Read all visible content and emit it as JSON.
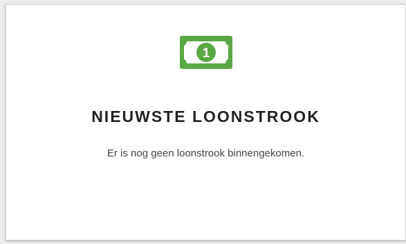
{
  "card": {
    "icon": "money-bill-icon",
    "accent_color": "#5aa843",
    "title": "NIEUWSTE LOONSTROOK",
    "message": "Er is nog geen loonstrook binnengekomen.",
    "icon_digit": "1"
  }
}
